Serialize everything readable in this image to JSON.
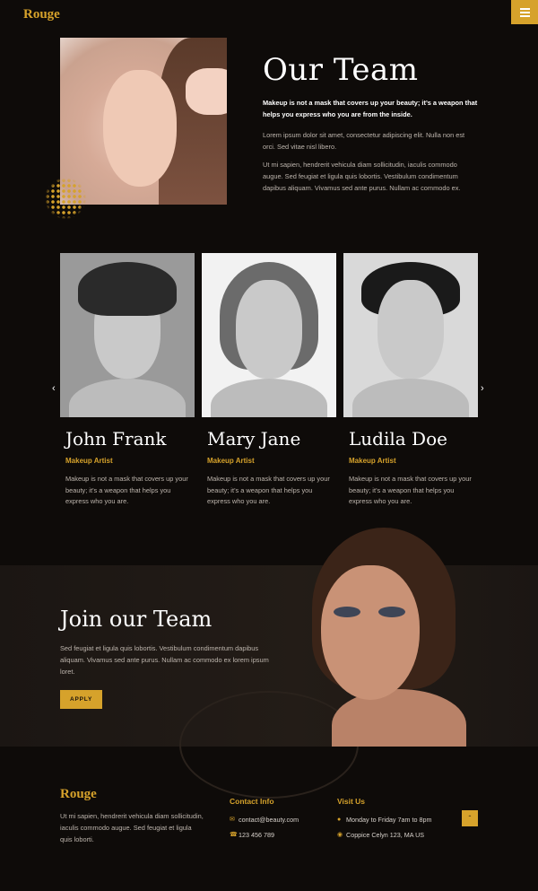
{
  "brand": {
    "logo": "Rouge",
    "accent": "#d6a22b"
  },
  "header": {
    "menu_icon": "hamburger-icon"
  },
  "intro": {
    "title": "Our Team",
    "lead": "Makeup is not a mask that covers up your beauty; it’s a weapon that helps you express who you are from the inside.",
    "p1": "Lorem ipsum dolor sit amet, consectetur adipiscing elit. Nulla non est orci. Sed vitae nisl libero.",
    "p2": "Ut mi sapien, hendrerit vehicula diam sollicitudin, iaculis commodo augue. Sed feugiat et ligula quis lobortis. Vestibulum condimentum dapibus aliquam. Vivamus sed ante purus. Nullam ac commodo ex."
  },
  "team": {
    "prev_icon": "chevron-left-icon",
    "next_icon": "chevron-right-icon",
    "members": [
      {
        "name": "John Frank",
        "role": "Makeup Artist",
        "desc": "Makeup is not a mask that covers up your beauty; it’s a weapon that helps you express who you are."
      },
      {
        "name": "Mary Jane",
        "role": "Makeup Artist",
        "desc": "Makeup is not a mask that covers up your beauty; it’s a weapon that helps you express who you are."
      },
      {
        "name": "Ludila Doe",
        "role": "Makeup Artist",
        "desc": "Makeup is not a mask that covers up your beauty; it’s a weapon that helps you express who you are."
      }
    ]
  },
  "join": {
    "title": "Join our Team",
    "text": "Sed feugiat et ligula quis lobortis. Vestibulum condimentum dapibus aliquam. Vivamus sed ante purus. Nullam ac commodo ex lorem ipsum loret.",
    "button": "APPLY"
  },
  "footer": {
    "logo": "Rouge",
    "about": "Ut mi sapien, hendrerit vehicula diam sollicitudin, iaculis commodo augue. Sed feugiat et ligula quis loborti.",
    "contact": {
      "title": "Contact Info",
      "email": "contact@beauty.com",
      "phone": "123 456 789"
    },
    "visit": {
      "title": "Visit Us",
      "hours": "Monday to Friday 7am to 8pm",
      "address": "Coppice Celyn 123, MA US"
    },
    "top_icon": "chevron-up-icon"
  }
}
